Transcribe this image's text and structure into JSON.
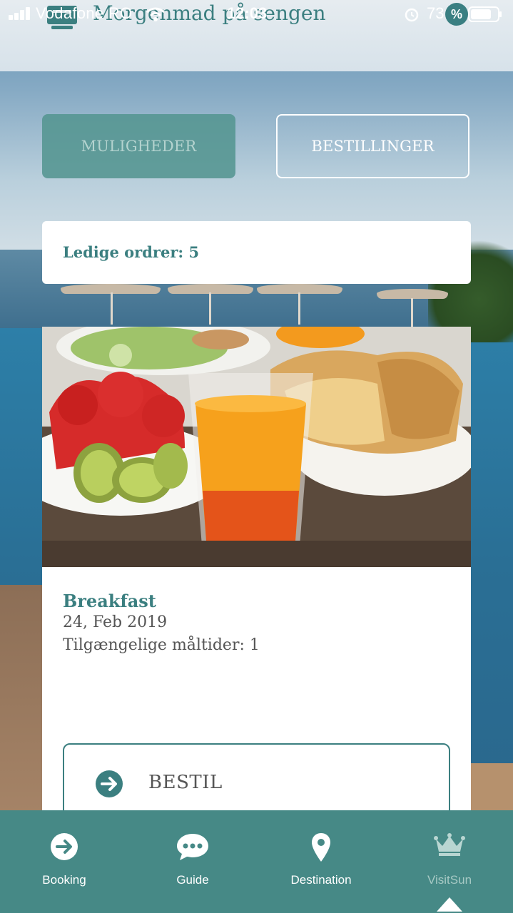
{
  "status_bar": {
    "carrier": "Vodafone RO",
    "time": "12:03",
    "battery_percent": "73"
  },
  "header": {
    "title": "Morgenmad på sengen",
    "badge": "%"
  },
  "tabs": [
    {
      "label": "MULIGHEDER",
      "active": true
    },
    {
      "label": "BESTILLINGER",
      "active": false
    }
  ],
  "orders": {
    "label": "Ledige ordrer: 5"
  },
  "meal": {
    "title": "Breakfast",
    "date": "24, Feb 2019",
    "availability": "Tilgængelige måltider: 1",
    "order_button": "BESTIL"
  },
  "bottom_nav": {
    "items": [
      {
        "label": "Booking",
        "icon": "arrow-circle-icon"
      },
      {
        "label": "Guide",
        "icon": "chat-bubble-icon"
      },
      {
        "label": "Destination",
        "icon": "map-pin-icon"
      },
      {
        "label": "VisitSun",
        "icon": "crown-icon",
        "selected": true
      }
    ]
  },
  "colors": {
    "brand_teal": "#3b7f80",
    "nav_background": "#468986",
    "tab_active": "#549591"
  }
}
